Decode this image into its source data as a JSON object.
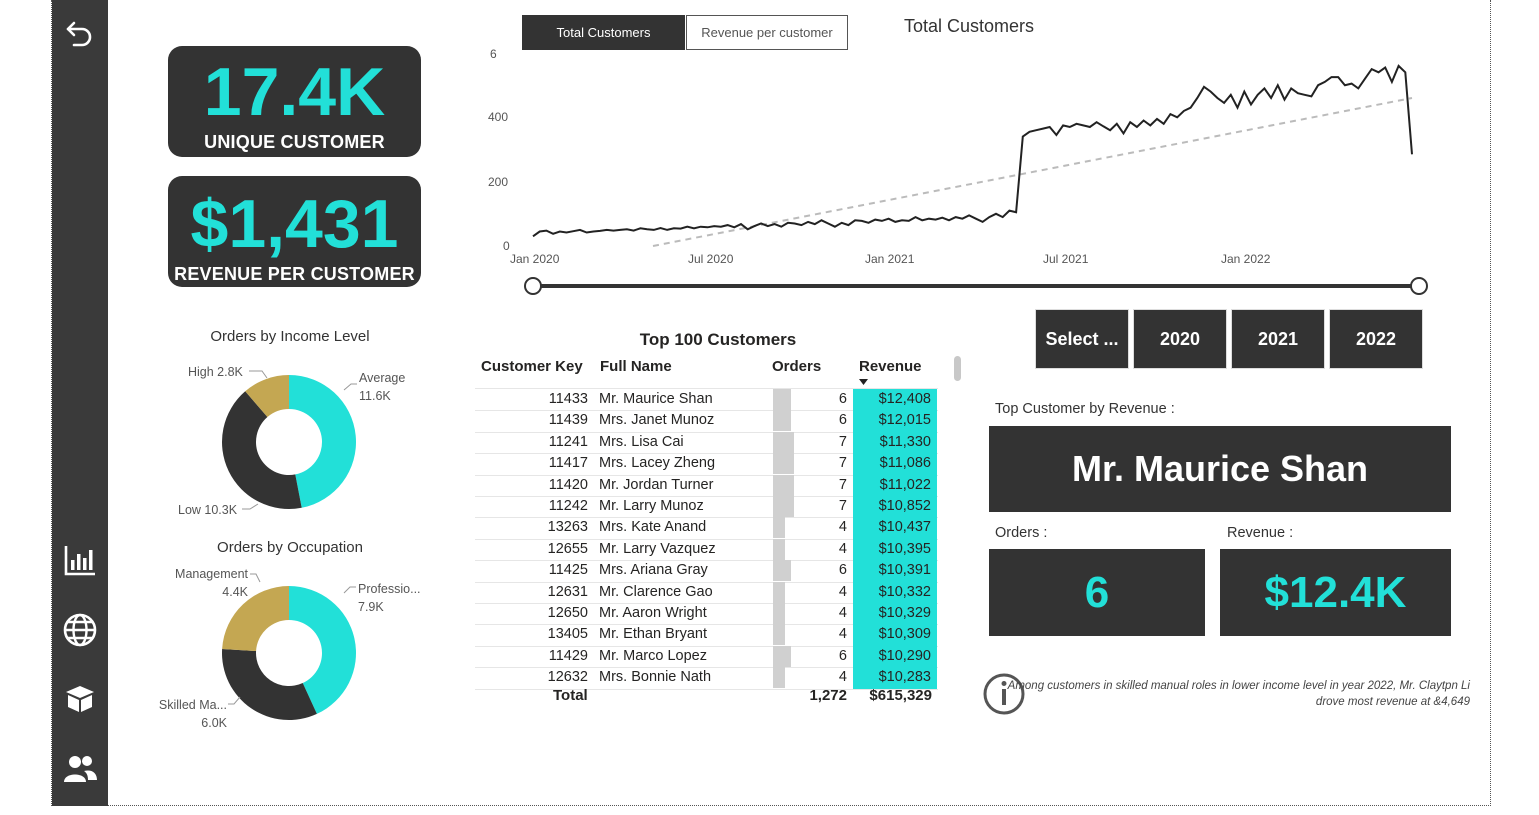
{
  "kpis": {
    "unique_customers": {
      "value": "17.4K",
      "label": "UNIQUE CUSTOMER"
    },
    "revenue_per_customer": {
      "value": "$1,431",
      "label": "REVENUE PER CUSTOMER"
    }
  },
  "toggle": {
    "active": "Total Customers",
    "inactive": "Revenue per customer"
  },
  "line_chart": {
    "title": "Total Customers",
    "y_ticks": [
      "6",
      "400",
      "200",
      "0"
    ],
    "x_ticks": [
      "Jan 2020",
      "Jul 2020",
      "Jan 2021",
      "Jul 2021",
      "Jan 2022"
    ]
  },
  "chart_data": [
    {
      "type": "line",
      "title": "Total Customers",
      "x_range": [
        "Jan 2020",
        "Jun 2022"
      ],
      "ylim": [
        0,
        600
      ],
      "series": [
        {
          "values": [
            30,
            45,
            48,
            38,
            45,
            42,
            46,
            50,
            42,
            45,
            47,
            50,
            48,
            50,
            52,
            48,
            55,
            52,
            50,
            56,
            50,
            55,
            54,
            60,
            55,
            60,
            58,
            62,
            60,
            65,
            58,
            68,
            52,
            62,
            70,
            62,
            68,
            60,
            72,
            70,
            65,
            75,
            68,
            80,
            70,
            60,
            72,
            65,
            80,
            78,
            72,
            82,
            78,
            85,
            75,
            80,
            78,
            90,
            80,
            85,
            82,
            88,
            80,
            90,
            85,
            95,
            85,
            75,
            90,
            100,
            90,
            110,
            105,
            340,
            355,
            360,
            365,
            370,
            345,
            375,
            370,
            380,
            375,
            370,
            385,
            372,
            360,
            380,
            350,
            385,
            370,
            390,
            375,
            395,
            380,
            410,
            400,
            420,
            430,
            460,
            495,
            480,
            460,
            445,
            470,
            430,
            480,
            440,
            470,
            490,
            460,
            500,
            455,
            490,
            475,
            470,
            465,
            500,
            510,
            525,
            525,
            500,
            505,
            490,
            520,
            550,
            540,
            555,
            510,
            560,
            540,
            285
          ]
        },
        {
          "values": [
            0,
            460
          ]
        }
      ]
    },
    {
      "type": "pie",
      "title": "Orders by Income Level",
      "labels": [
        "Average",
        "Low",
        "High"
      ],
      "values": [
        11.6,
        10.3,
        2.8
      ],
      "display": [
        "11.6K",
        "10.3K",
        "2.8K"
      ],
      "colors": [
        "#22e0d8",
        "#333333",
        "#c4a752"
      ]
    },
    {
      "type": "pie",
      "title": "Orders by Occupation",
      "labels": [
        "Professio...",
        "Skilled Ma...",
        "Management"
      ],
      "values": [
        7.9,
        6.0,
        4.4
      ],
      "display": [
        "7.9K",
        "6.0K",
        "4.4K"
      ],
      "colors": [
        "#22e0d8",
        "#333333",
        "#c4a752"
      ]
    }
  ],
  "income_donut": {
    "title": "Orders by Income Level",
    "labels": {
      "average": "Average",
      "average_val": "11.6K",
      "low": "Low 10.3K",
      "high": "High 2.8K"
    }
  },
  "occupation_donut": {
    "title": "Orders by Occupation",
    "labels": {
      "prof": "Professio...",
      "prof_val": "7.9K",
      "skilled": "Skilled Ma...",
      "skilled_val": "6.0K",
      "mgmt": "Management",
      "mgmt_val": "4.4K"
    }
  },
  "table": {
    "title": "Top 100 Customers",
    "columns": [
      "Customer Key",
      "Full Name",
      "Orders",
      "Revenue"
    ],
    "rows": [
      {
        "key": "11433",
        "name": "Mr. Maurice Shan",
        "orders": "6",
        "revenue": "$12,408"
      },
      {
        "key": "11439",
        "name": "Mrs. Janet Munoz",
        "orders": "6",
        "revenue": "$12,015"
      },
      {
        "key": "11241",
        "name": "Mrs. Lisa Cai",
        "orders": "7",
        "revenue": "$11,330"
      },
      {
        "key": "11417",
        "name": "Mrs. Lacey Zheng",
        "orders": "7",
        "revenue": "$11,086"
      },
      {
        "key": "11420",
        "name": "Mr. Jordan Turner",
        "orders": "7",
        "revenue": "$11,022"
      },
      {
        "key": "11242",
        "name": "Mr. Larry Munoz",
        "orders": "7",
        "revenue": "$10,852"
      },
      {
        "key": "13263",
        "name": "Mrs. Kate Anand",
        "orders": "4",
        "revenue": "$10,437"
      },
      {
        "key": "12655",
        "name": "Mr. Larry Vazquez",
        "orders": "4",
        "revenue": "$10,395"
      },
      {
        "key": "11425",
        "name": "Mrs. Ariana Gray",
        "orders": "6",
        "revenue": "$10,391"
      },
      {
        "key": "12631",
        "name": "Mr. Clarence Gao",
        "orders": "4",
        "revenue": "$10,332"
      },
      {
        "key": "12650",
        "name": "Mr. Aaron Wright",
        "orders": "4",
        "revenue": "$10,329"
      },
      {
        "key": "13405",
        "name": "Mr. Ethan Bryant",
        "orders": "4",
        "revenue": "$10,309"
      },
      {
        "key": "11429",
        "name": "Mr. Marco Lopez",
        "orders": "6",
        "revenue": "$10,290"
      },
      {
        "key": "12632",
        "name": "Mrs. Bonnie Nath",
        "orders": "4",
        "revenue": "$10,283"
      }
    ],
    "total_label": "Total",
    "total_orders": "1,272",
    "total_revenue": "$615,329"
  },
  "year_slicer": [
    "Select ...",
    "2020",
    "2021",
    "2022"
  ],
  "top_customer": {
    "label": "Top Customer by Revenue :",
    "name": "Mr. Maurice Shan",
    "orders_label": "Orders :",
    "orders": "6",
    "revenue_label": "Revenue :",
    "revenue": "$12.4K"
  },
  "insight": {
    "line1": "Among customers in skilled manual roles in lower income level in year 2022, Mr. Claytpn Li",
    "line2": "drove most revenue at &4,649"
  },
  "colors": {
    "accent": "#22e0d8",
    "dark": "#333333",
    "gold": "#c4a752",
    "sidebar": "#3a3a3a"
  },
  "icons": [
    "back-arrow-icon",
    "bar-chart-icon",
    "globe-icon",
    "box-icon",
    "users-icon",
    "info-icon"
  ]
}
